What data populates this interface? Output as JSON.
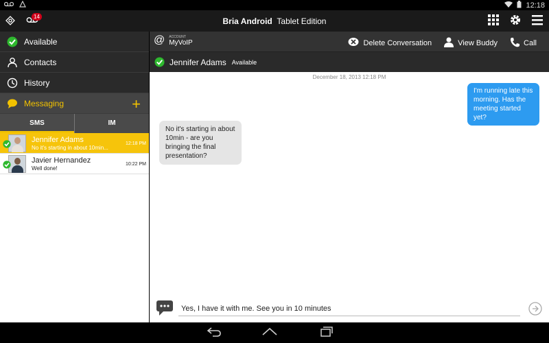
{
  "statusbar": {
    "time": "12:18",
    "icons": [
      "voicemail-icon",
      "bria-status-icon",
      "wifi-icon",
      "battery-icon"
    ]
  },
  "actionbar": {
    "app_name": "Bria Android",
    "edition": "Tablet Edition",
    "voicemail_count": "14",
    "icons": [
      "bria-logo-icon",
      "voicemail-icon",
      "dialpad-grid-icon",
      "settings-gear-icon",
      "overflow-menu-icon"
    ]
  },
  "sidebar": {
    "status": "Available",
    "contacts": "Contacts",
    "history": "History",
    "messaging": "Messaging",
    "tabs": [
      "SMS",
      "IM"
    ],
    "active_tab": "SMS"
  },
  "conversations": [
    {
      "name": "Jennifer Adams",
      "preview": "No it's starting in about 10min...",
      "time": "12:18 PM",
      "active": true
    },
    {
      "name": "Javier Hernandez",
      "preview": "Well done!",
      "time": "10:22 PM",
      "active": false
    }
  ],
  "conversation_header": {
    "account_caption": "ACCOUNT",
    "account_name": "MyVoIP",
    "delete_label": "Delete Conversation",
    "view_buddy_label": "View Buddy",
    "call_label": "Call",
    "buddy_name": "Jennifer Adams",
    "buddy_status": "Available"
  },
  "messages": {
    "timestamp": "December 18, 2013 12:18 PM",
    "outgoing": "I'm running late this morning. Has the meeting started yet?",
    "incoming": "No it's starting in about 10min - are you bringing the final presentation?"
  },
  "compose": {
    "text": "Yes, I have it with me. See you in 10 minutes"
  },
  "colors": {
    "accent": "#f6c40b",
    "outgoing_bubble": "#2d9bf0",
    "status_green": "#2eb82e"
  }
}
